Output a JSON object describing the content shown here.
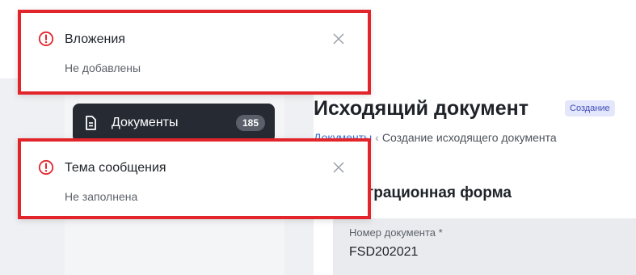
{
  "sidebar": {
    "active_item": {
      "label": "Документы",
      "count": "185",
      "icon": "document-icon"
    }
  },
  "document": {
    "title": "Исходящий документ",
    "status": "Создание",
    "breadcrumb": {
      "link": "Документы",
      "current": "Создание исходящего документа"
    },
    "form_title": "Регистрационная форма",
    "fields": {
      "number": {
        "label": "Номер документа *",
        "value": "FSD202021"
      }
    }
  },
  "notifications": [
    {
      "title": "Вложения",
      "text": "Не добавлены",
      "icon": "alert-circle-icon",
      "close_icon": "close-icon"
    },
    {
      "title": "Тема сообщения",
      "text": "Не заполнена",
      "icon": "alert-circle-icon",
      "close_icon": "close-icon"
    }
  ],
  "colors": {
    "alert": "#e2252b",
    "highlight_border": "#e2252b",
    "nav_active_bg": "#262a33",
    "link": "#3f6fd8",
    "badge_bg": "#e4e7fb"
  }
}
